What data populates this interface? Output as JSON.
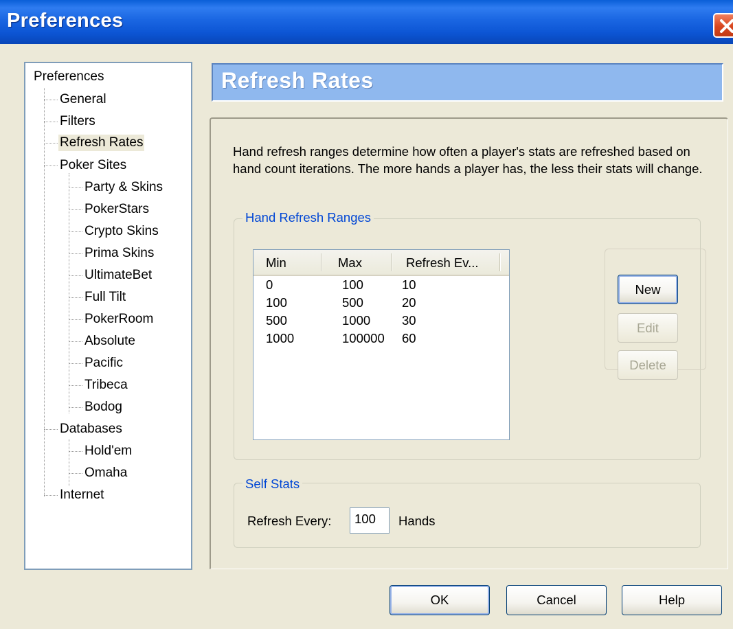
{
  "window": {
    "title": "Preferences"
  },
  "tree": {
    "root": "Preferences",
    "items": [
      {
        "label": "General"
      },
      {
        "label": "Filters"
      },
      {
        "label": "Refresh Rates",
        "selected": true
      },
      {
        "label": "Poker Sites"
      },
      {
        "label": "Party & Skins"
      },
      {
        "label": "PokerStars"
      },
      {
        "label": "Crypto Skins"
      },
      {
        "label": "Prima Skins"
      },
      {
        "label": "UltimateBet"
      },
      {
        "label": "Full Tilt"
      },
      {
        "label": "PokerRoom"
      },
      {
        "label": "Absolute"
      },
      {
        "label": "Pacific"
      },
      {
        "label": "Tribeca"
      },
      {
        "label": "Bodog"
      },
      {
        "label": "Databases"
      },
      {
        "label": "Hold'em"
      },
      {
        "label": "Omaha"
      },
      {
        "label": "Internet"
      }
    ]
  },
  "header": {
    "title": "Refresh Rates"
  },
  "description": "Hand refresh ranges determine how often a player's stats are refreshed based on hand count iterations.  The more hands a player has, the less their stats will change.",
  "hand_refresh": {
    "group_label": "Hand Refresh Ranges",
    "columns": [
      "Min",
      "Max",
      "Refresh Ev..."
    ],
    "rows": [
      [
        "0",
        "100",
        "10"
      ],
      [
        "100",
        "500",
        "20"
      ],
      [
        "500",
        "1000",
        "30"
      ],
      [
        "1000",
        "100000",
        "60"
      ]
    ],
    "new_label": "New",
    "edit_label": "Edit",
    "delete_label": "Delete"
  },
  "self_stats": {
    "group_label": "Self Stats",
    "refresh_label": "Refresh Every:",
    "value": "100",
    "unit": "Hands"
  },
  "footer": {
    "ok_label": "OK",
    "cancel_label": "Cancel",
    "help_label": "Help"
  },
  "colors": {
    "titlebar": "#0c55d4",
    "banner": "#8fb8ee",
    "group_label": "#0046d5",
    "face": "#ece9d8"
  }
}
